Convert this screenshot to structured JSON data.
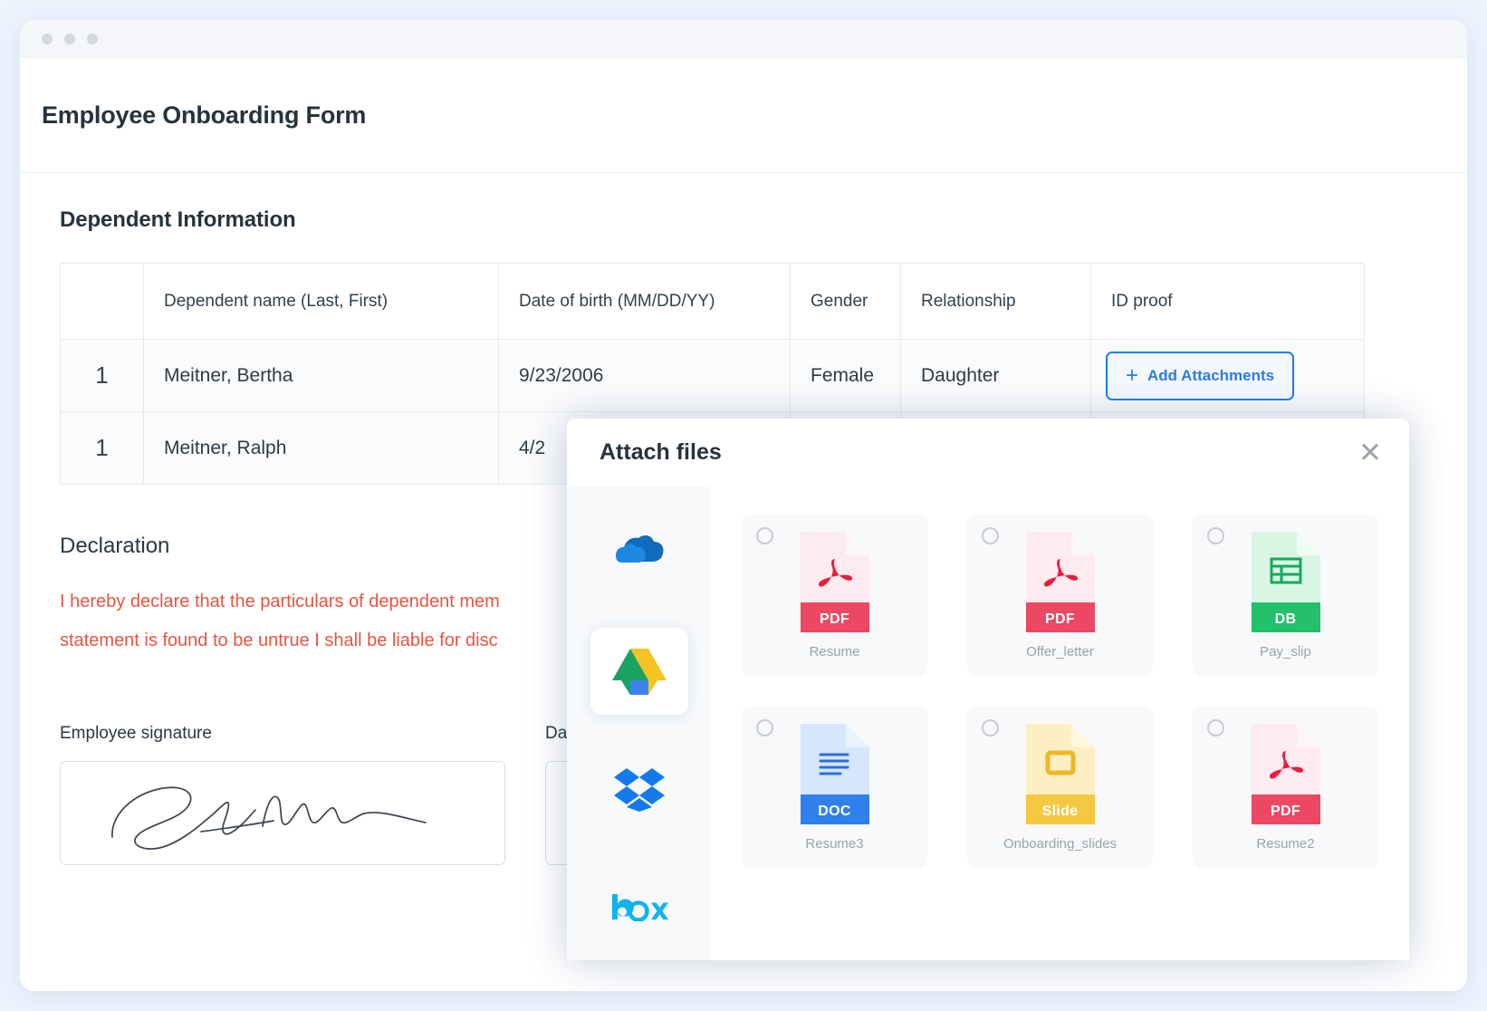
{
  "window": {
    "dots": [
      "dot-1",
      "dot-2",
      "dot-3"
    ]
  },
  "form": {
    "title": "Employee Onboarding Form",
    "section_title": "Dependent Information"
  },
  "table": {
    "columns": [
      "",
      "Dependent name (Last, First)",
      "Date of birth (MM/DD/YY)",
      "Gender",
      "Relationship",
      "ID proof"
    ],
    "rows": [
      {
        "index": "1",
        "name": "Meitner, Bertha",
        "dob": "9/23/2006",
        "gender": "Female",
        "relationship": "Daughter",
        "id_proof_button": "Add Attachments"
      },
      {
        "index": "1",
        "name": "Meitner, Ralph",
        "dob": "4/2",
        "gender": "",
        "relationship": "",
        "id_proof_button": ""
      }
    ]
  },
  "declaration": {
    "heading": "Declaration",
    "line1": "I hereby declare that the particulars of dependent mem",
    "line2": "statement is found to be untrue I shall be liable for disc"
  },
  "signature": {
    "label": "Employee signature",
    "date_label": "Dat"
  },
  "modal": {
    "title": "Attach files",
    "close_icon": "close-icon",
    "services": [
      {
        "id": "onedrive",
        "name": "onedrive-icon",
        "active": false
      },
      {
        "id": "googledrive",
        "name": "google-drive-icon",
        "active": true
      },
      {
        "id": "dropbox",
        "name": "dropbox-icon",
        "active": false
      },
      {
        "id": "box",
        "name": "box-icon",
        "active": false
      }
    ],
    "files": [
      {
        "name": "Resume",
        "type": "PDF",
        "kind": "pdf"
      },
      {
        "name": "Offer_letter",
        "type": "PDF",
        "kind": "pdf"
      },
      {
        "name": "Pay_slip",
        "type": "DB",
        "kind": "db"
      },
      {
        "name": "Resume3",
        "type": "DOC",
        "kind": "doc"
      },
      {
        "name": "Onboarding_slides",
        "type": "Slide",
        "kind": "slide"
      },
      {
        "name": "Resume2",
        "type": "PDF",
        "kind": "pdf"
      }
    ]
  },
  "colors": {
    "accent_blue": "#2c7be5",
    "declaration_red": "#e8543f",
    "pdf": "#ec4863",
    "db": "#22c06a",
    "doc": "#2f80ed",
    "slide": "#f5c842",
    "page_bg": "#eef4fe"
  }
}
